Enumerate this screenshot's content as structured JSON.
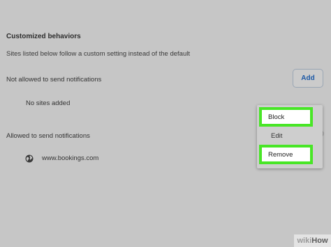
{
  "settings": {
    "section_title": "Customized behaviors",
    "section_desc": "Sites listed below follow a custom setting instead of the default",
    "blocked": {
      "label": "Not allowed to send notifications",
      "add_label": "Add",
      "empty_text": "No sites added"
    },
    "allowed": {
      "label": "Allowed to send notifications",
      "sites": [
        {
          "name": "www.bookings.com",
          "icon": "globe-icon"
        }
      ]
    }
  },
  "context_menu": {
    "items": [
      {
        "label": "Block",
        "highlighted": true
      },
      {
        "label": "Edit",
        "highlighted": false
      },
      {
        "label": "Remove",
        "highlighted": true
      }
    ],
    "highlight_color": "#48e626"
  },
  "watermark": {
    "wiki": "wiki",
    "how": "How"
  }
}
